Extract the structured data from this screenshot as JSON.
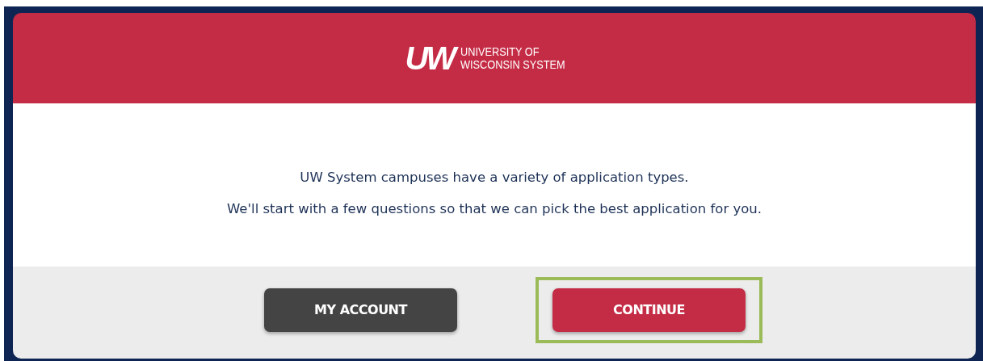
{
  "header": {
    "logo_mark": "UW",
    "logo_text": [
      "UNIVERSITY OF",
      "WISCONSIN SYSTEM"
    ]
  },
  "message": [
    "UW System campuses have a variety of application types.",
    "We'll start with a few questions so that we can pick the best application for you."
  ],
  "buttons": [
    {
      "label": "MY ACCOUNT",
      "kind": "secondary",
      "highlighted": false
    },
    {
      "label": "CONTINUE",
      "kind": "primary",
      "highlighted": true
    }
  ]
}
